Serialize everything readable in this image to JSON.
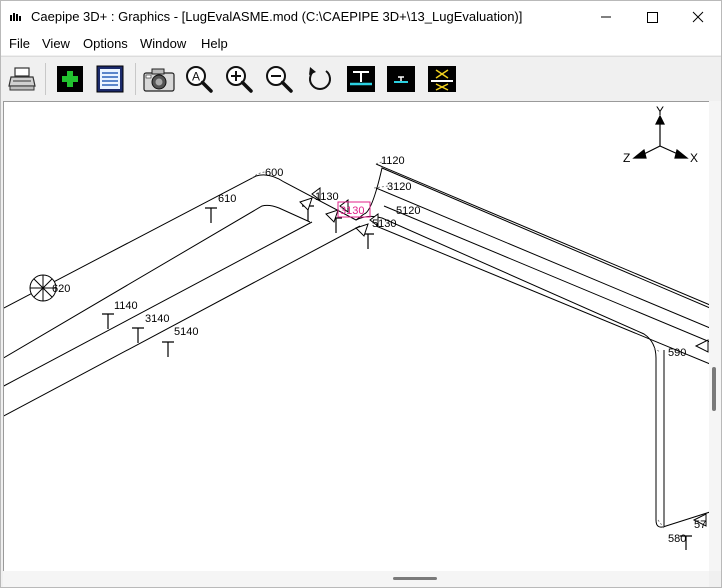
{
  "window": {
    "title": "Caepipe 3D+ : Graphics -  [LugEvalASME.mod (C:\\CAEPIPE 3D+\\13_LugEvaluation)]"
  },
  "menu": [
    "File",
    "View",
    "Options",
    "Window",
    "Help"
  ],
  "toolbar": [
    {
      "name": "print-button",
      "icon": "printer-icon"
    },
    {
      "name": "add-button",
      "icon": "plus-icon"
    },
    {
      "name": "list-button",
      "icon": "list-icon"
    },
    {
      "name": "camera-button",
      "icon": "camera-icon"
    },
    {
      "name": "zoom-auto-button",
      "icon": "zoom-a-icon"
    },
    {
      "name": "zoom-in-button",
      "icon": "zoom-in-icon"
    },
    {
      "name": "zoom-out-button",
      "icon": "zoom-out-icon"
    },
    {
      "name": "rotate-button",
      "icon": "rotate-icon"
    },
    {
      "name": "support-view-button",
      "icon": "support-icon"
    },
    {
      "name": "anchor-view-button",
      "icon": "anchor-icon"
    },
    {
      "name": "restraint-view-button",
      "icon": "restraint-icon"
    }
  ],
  "axes": {
    "y": "Y",
    "z": "Z",
    "x": "X"
  },
  "nodes": {
    "n600": "600",
    "n610": "610",
    "n620": "620",
    "n1120": "1120",
    "n1130": "1130",
    "n1140": "1140",
    "n3120": "3120",
    "n3130": "3130",
    "n3140": "3140",
    "n5120": "5120",
    "n5130": "5130",
    "n5140": "5140",
    "n590": "590",
    "n580": "580",
    "n57": "57"
  },
  "colors": {
    "highlight": "#e0208a",
    "pipe": "#000000",
    "toolbar_icon_bg": "#000000",
    "toolbar_icon_accent": "#22c32f"
  }
}
